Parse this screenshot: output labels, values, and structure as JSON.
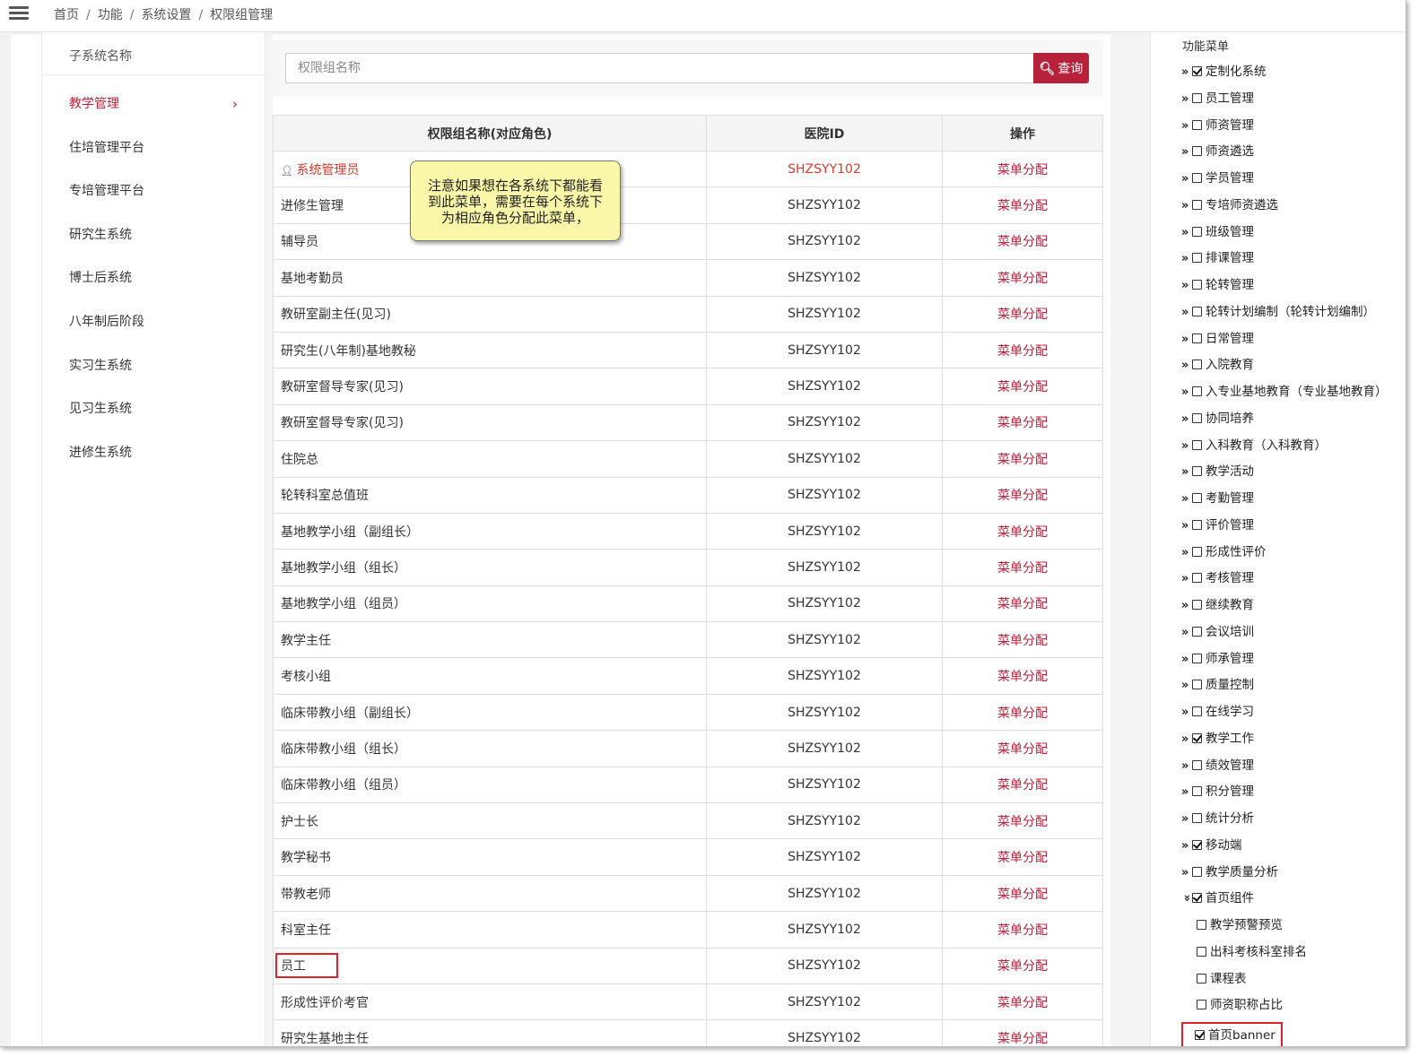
{
  "breadcrumb": [
    "首页",
    "功能",
    "系统设置",
    "权限组管理"
  ],
  "left_panel": {
    "title": "子系统名称",
    "items": [
      {
        "label": "教学管理",
        "active": true
      },
      {
        "label": "住培管理平台"
      },
      {
        "label": "专培管理平台"
      },
      {
        "label": "研究生系统"
      },
      {
        "label": "博士后系统"
      },
      {
        "label": "八年制后阶段"
      },
      {
        "label": "实习生系统"
      },
      {
        "label": "见习生系统"
      },
      {
        "label": "进修生系统"
      }
    ]
  },
  "search": {
    "placeholder": "权限组名称",
    "value": "",
    "button_label": "查询"
  },
  "table": {
    "headers": [
      "权限组名称(对应角色)",
      "医院ID",
      "操作"
    ],
    "rows": [
      {
        "name": "系统管理员",
        "hospital_id": "SHZSYY102",
        "action": "菜单分配",
        "admin": true
      },
      {
        "name": "进修生管理",
        "hospital_id": "SHZSYY102",
        "action": "菜单分配"
      },
      {
        "name": "辅导员",
        "hospital_id": "SHZSYY102",
        "action": "菜单分配"
      },
      {
        "name": "基地考勤员",
        "hospital_id": "SHZSYY102",
        "action": "菜单分配"
      },
      {
        "name": "教研室副主任(见习)",
        "hospital_id": "SHZSYY102",
        "action": "菜单分配"
      },
      {
        "name": "研究生(八年制)基地教秘",
        "hospital_id": "SHZSYY102",
        "action": "菜单分配"
      },
      {
        "name": "教研室督导专家(见习)",
        "hospital_id": "SHZSYY102",
        "action": "菜单分配"
      },
      {
        "name": "教研室督导专家(见习)",
        "hospital_id": "SHZSYY102",
        "action": "菜单分配"
      },
      {
        "name": "住院总",
        "hospital_id": "SHZSYY102",
        "action": "菜单分配"
      },
      {
        "name": "轮转科室总值班",
        "hospital_id": "SHZSYY102",
        "action": "菜单分配"
      },
      {
        "name": "基地教学小组（副组长）",
        "hospital_id": "SHZSYY102",
        "action": "菜单分配"
      },
      {
        "name": "基地教学小组（组长）",
        "hospital_id": "SHZSYY102",
        "action": "菜单分配"
      },
      {
        "name": "基地教学小组（组员）",
        "hospital_id": "SHZSYY102",
        "action": "菜单分配"
      },
      {
        "name": "教学主任",
        "hospital_id": "SHZSYY102",
        "action": "菜单分配"
      },
      {
        "name": "考核小组",
        "hospital_id": "SHZSYY102",
        "action": "菜单分配"
      },
      {
        "name": "临床带教小组（副组长）",
        "hospital_id": "SHZSYY102",
        "action": "菜单分配"
      },
      {
        "name": "临床带教小组（组长）",
        "hospital_id": "SHZSYY102",
        "action": "菜单分配"
      },
      {
        "name": "临床带教小组（组员）",
        "hospital_id": "SHZSYY102",
        "action": "菜单分配"
      },
      {
        "name": "护士长",
        "hospital_id": "SHZSYY102",
        "action": "菜单分配"
      },
      {
        "name": "教学秘书",
        "hospital_id": "SHZSYY102",
        "action": "菜单分配"
      },
      {
        "name": "带教老师",
        "hospital_id": "SHZSYY102",
        "action": "菜单分配"
      },
      {
        "name": "科室主任",
        "hospital_id": "SHZSYY102",
        "action": "菜单分配"
      },
      {
        "name": "员工",
        "hospital_id": "SHZSYY102",
        "action": "菜单分配",
        "highlighted": true
      },
      {
        "name": "形成性评价考官",
        "hospital_id": "SHZSYY102",
        "action": "菜单分配"
      },
      {
        "name": "研究生基地主任",
        "hospital_id": "SHZSYY102",
        "action": "菜单分配"
      }
    ]
  },
  "tooltip": {
    "lines": [
      "注意如果想在各系统下都能看",
      "到此菜单，需要在每个系统下",
      "为相应角色分配此菜单，"
    ]
  },
  "function_menu": {
    "title": "功能菜单",
    "items": [
      {
        "label": "定制化系统",
        "checked": true,
        "arrow": "»"
      },
      {
        "label": "员工管理",
        "checked": false,
        "arrow": "»"
      },
      {
        "label": "师资管理",
        "checked": false,
        "arrow": "»"
      },
      {
        "label": "师资遴选",
        "checked": false,
        "arrow": "»"
      },
      {
        "label": "学员管理",
        "checked": false,
        "arrow": "»"
      },
      {
        "label": "专培师资遴选",
        "checked": false,
        "arrow": "»"
      },
      {
        "label": "班级管理",
        "checked": false,
        "arrow": "»"
      },
      {
        "label": "排课管理",
        "checked": false,
        "arrow": "»"
      },
      {
        "label": "轮转管理",
        "checked": false,
        "arrow": "»"
      },
      {
        "label": "轮转计划编制（轮转计划编制）",
        "checked": false,
        "arrow": "»"
      },
      {
        "label": "日常管理",
        "checked": false,
        "arrow": "»"
      },
      {
        "label": "入院教育",
        "checked": false,
        "arrow": "»"
      },
      {
        "label": "入专业基地教育（专业基地教育）",
        "checked": false,
        "arrow": "»"
      },
      {
        "label": "协同培养",
        "checked": false,
        "arrow": "»"
      },
      {
        "label": "入科教育（入科教育）",
        "checked": false,
        "arrow": "»"
      },
      {
        "label": "教学活动",
        "checked": false,
        "arrow": "»"
      },
      {
        "label": "考勤管理",
        "checked": false,
        "arrow": "»"
      },
      {
        "label": "评价管理",
        "checked": false,
        "arrow": "»"
      },
      {
        "label": "形成性评价",
        "checked": false,
        "arrow": "»"
      },
      {
        "label": "考核管理",
        "checked": false,
        "arrow": "»"
      },
      {
        "label": "继续教育",
        "checked": false,
        "arrow": "»"
      },
      {
        "label": "会议培训",
        "checked": false,
        "arrow": "»"
      },
      {
        "label": "师承管理",
        "checked": false,
        "arrow": "»"
      },
      {
        "label": "质量控制",
        "checked": false,
        "arrow": "»"
      },
      {
        "label": "在线学习",
        "checked": false,
        "arrow": "»"
      },
      {
        "label": "教学工作",
        "checked": true,
        "arrow": "»"
      },
      {
        "label": "绩效管理",
        "checked": false,
        "arrow": "»"
      },
      {
        "label": "积分管理",
        "checked": false,
        "arrow": "»"
      },
      {
        "label": "统计分析",
        "checked": false,
        "arrow": "»"
      },
      {
        "label": "移动端",
        "checked": true,
        "arrow": "»"
      },
      {
        "label": "教学质量分析",
        "checked": false,
        "arrow": "»"
      },
      {
        "label": "首页组件",
        "checked": true,
        "arrow": "»",
        "expanded": true,
        "children": [
          {
            "label": "教学预警预览",
            "checked": false
          },
          {
            "label": "出科考核科室排名",
            "checked": false
          },
          {
            "label": "课程表",
            "checked": false
          },
          {
            "label": "师资职称占比",
            "checked": false
          },
          {
            "label": "首页banner",
            "checked": true,
            "highlighted": true
          }
        ]
      }
    ]
  },
  "colors": {
    "accent": "#b8213a",
    "admin_red": "#d33a2c",
    "highlight_border": "#d9232d",
    "tooltip_bg": "#fbf7a8"
  }
}
